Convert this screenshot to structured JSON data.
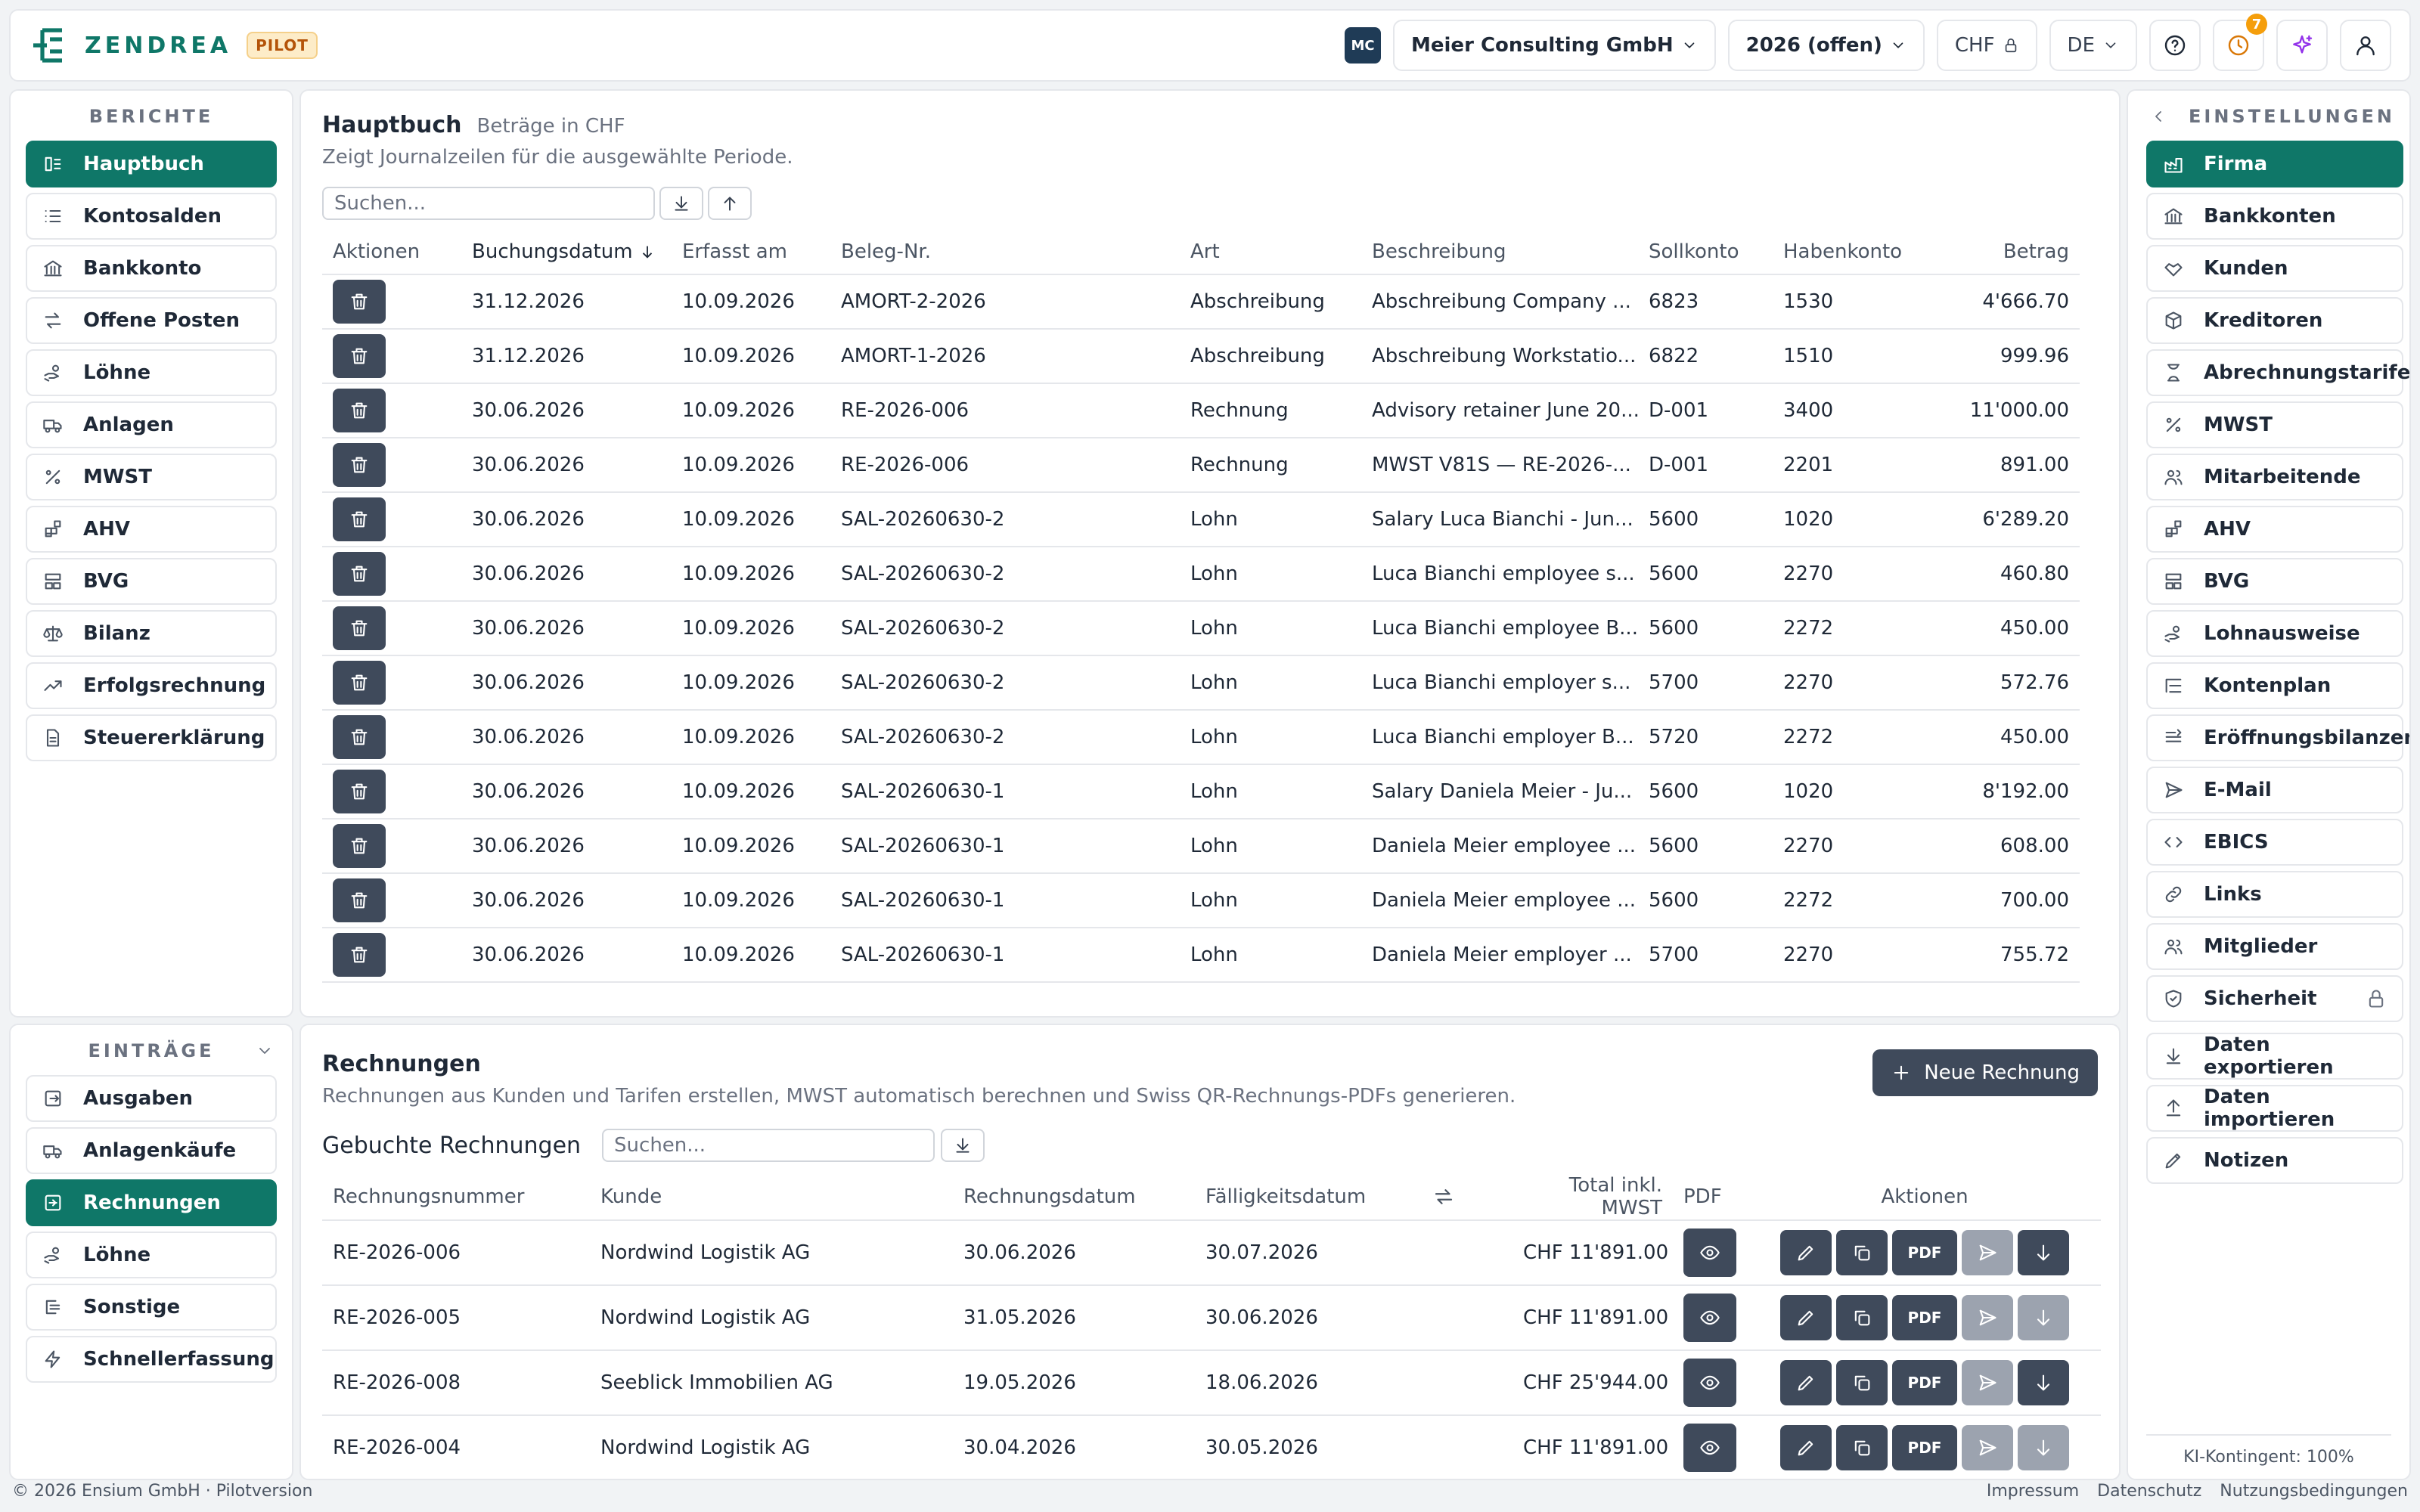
{
  "brand": {
    "name": "ZENDREA",
    "badge": "PILOT"
  },
  "topbar": {
    "company_initials": "MC",
    "company": "Meier Consulting GmbH",
    "year": "2026 (offen)",
    "currency": "CHF",
    "language": "DE",
    "notifications": "7"
  },
  "reports_nav": {
    "title": "BERICHTE",
    "items": [
      {
        "label": "Hauptbuch",
        "icon": "ledger-icon",
        "active": true
      },
      {
        "label": "Kontosalden",
        "icon": "list-icon"
      },
      {
        "label": "Bankkonto",
        "icon": "bank-icon"
      },
      {
        "label": "Offene Posten",
        "icon": "swap-icon"
      },
      {
        "label": "Löhne",
        "icon": "hand-coins-icon"
      },
      {
        "label": "Anlagen",
        "icon": "truck-icon"
      },
      {
        "label": "MWST",
        "icon": "percent-icon"
      },
      {
        "label": "AHV",
        "icon": "blocks-icon"
      },
      {
        "label": "BVG",
        "icon": "layout-icon"
      },
      {
        "label": "Bilanz",
        "icon": "scale-icon"
      },
      {
        "label": "Erfolgsrechnung",
        "icon": "trend-icon"
      },
      {
        "label": "Steuererklärung",
        "icon": "file-icon"
      }
    ]
  },
  "entries_nav": {
    "title": "EINTRÄGE",
    "items": [
      {
        "label": "Ausgaben",
        "icon": "receipt-icon"
      },
      {
        "label": "Anlagenkäufe",
        "icon": "truck-icon"
      },
      {
        "label": "Rechnungen",
        "icon": "invoice-icon",
        "active": true
      },
      {
        "label": "Löhne",
        "icon": "hand-coins-icon"
      },
      {
        "label": "Sonstige",
        "icon": "misc-icon"
      },
      {
        "label": "Schnellerfassung",
        "icon": "zap-icon"
      }
    ]
  },
  "settings_nav": {
    "title": "EINSTELLUNGEN",
    "items": [
      {
        "label": "Firma",
        "icon": "factory-icon",
        "active": true
      },
      {
        "label": "Bankkonten",
        "icon": "bank-icon"
      },
      {
        "label": "Kunden",
        "icon": "handshake-icon"
      },
      {
        "label": "Kreditoren",
        "icon": "package-icon"
      },
      {
        "label": "Abrechnungstarife",
        "icon": "hourglass-icon"
      },
      {
        "label": "MWST",
        "icon": "percent-icon"
      },
      {
        "label": "Mitarbeitende",
        "icon": "users-icon"
      },
      {
        "label": "AHV",
        "icon": "blocks-icon"
      },
      {
        "label": "BVG",
        "icon": "layout-icon"
      },
      {
        "label": "Lohnausweise",
        "icon": "hand-coins-icon"
      },
      {
        "label": "Kontenplan",
        "icon": "list-tree-icon"
      },
      {
        "label": "Eröffnungsbilanzen",
        "icon": "opening-icon"
      },
      {
        "label": "E-Mail",
        "icon": "send-icon"
      },
      {
        "label": "EBICS",
        "icon": "code-icon"
      },
      {
        "label": "Links",
        "icon": "link-icon"
      },
      {
        "label": "Mitglieder",
        "icon": "users-icon"
      },
      {
        "label": "Sicherheit",
        "icon": "shield-icon",
        "lock": true
      }
    ],
    "extra": [
      {
        "label": "Daten exportieren",
        "icon": "download-icon"
      },
      {
        "label": "Daten importieren",
        "icon": "upload-icon"
      },
      {
        "label": "Notizen",
        "icon": "pen-icon"
      }
    ],
    "ai_quota": "KI-Kontingent: 100%"
  },
  "ledger": {
    "title": "Hauptbuch",
    "currency_note": "Beträge in CHF",
    "subtitle": "Zeigt Journalzeilen für die ausgewählte Periode.",
    "search_placeholder": "Suchen...",
    "columns": [
      "Aktionen",
      "Buchungsdatum",
      "Erfasst am",
      "Beleg-Nr.",
      "Art",
      "Beschreibung",
      "Sollkonto",
      "Habenkonto",
      "Betrag"
    ],
    "rows": [
      [
        "31.12.2026",
        "10.09.2026",
        "AMORT-2-2026",
        "Abschreibung",
        "Abschreibung Company ...",
        "6823",
        "1530",
        "4'666.70"
      ],
      [
        "31.12.2026",
        "10.09.2026",
        "AMORT-1-2026",
        "Abschreibung",
        "Abschreibung Workstatio...",
        "6822",
        "1510",
        "999.96"
      ],
      [
        "30.06.2026",
        "10.09.2026",
        "RE-2026-006",
        "Rechnung",
        "Advisory retainer June 20...",
        "D-001",
        "3400",
        "11'000.00"
      ],
      [
        "30.06.2026",
        "10.09.2026",
        "RE-2026-006",
        "Rechnung",
        "MWST V81S — RE-2026-...",
        "D-001",
        "2201",
        "891.00"
      ],
      [
        "30.06.2026",
        "10.09.2026",
        "SAL-20260630-2",
        "Lohn",
        "Salary Luca Bianchi - Jun...",
        "5600",
        "1020",
        "6'289.20"
      ],
      [
        "30.06.2026",
        "10.09.2026",
        "SAL-20260630-2",
        "Lohn",
        "Luca Bianchi employee s...",
        "5600",
        "2270",
        "460.80"
      ],
      [
        "30.06.2026",
        "10.09.2026",
        "SAL-20260630-2",
        "Lohn",
        "Luca Bianchi employee B...",
        "5600",
        "2272",
        "450.00"
      ],
      [
        "30.06.2026",
        "10.09.2026",
        "SAL-20260630-2",
        "Lohn",
        "Luca Bianchi employer s...",
        "5700",
        "2270",
        "572.76"
      ],
      [
        "30.06.2026",
        "10.09.2026",
        "SAL-20260630-2",
        "Lohn",
        "Luca Bianchi employer B...",
        "5720",
        "2272",
        "450.00"
      ],
      [
        "30.06.2026",
        "10.09.2026",
        "SAL-20260630-1",
        "Lohn",
        "Salary Daniela Meier - Ju...",
        "5600",
        "1020",
        "8'192.00"
      ],
      [
        "30.06.2026",
        "10.09.2026",
        "SAL-20260630-1",
        "Lohn",
        "Daniela Meier employee ...",
        "5600",
        "2270",
        "608.00"
      ],
      [
        "30.06.2026",
        "10.09.2026",
        "SAL-20260630-1",
        "Lohn",
        "Daniela Meier employee ...",
        "5600",
        "2272",
        "700.00"
      ],
      [
        "30.06.2026",
        "10.09.2026",
        "SAL-20260630-1",
        "Lohn",
        "Daniela Meier employer ...",
        "5700",
        "2270",
        "755.72"
      ]
    ]
  },
  "invoices": {
    "title": "Rechnungen",
    "subtitle": "Rechnungen aus Kunden und Tarifen erstellen, MWST automatisch berechnen und Swiss QR-Rechnungs-PDFs generieren.",
    "new_button": "Neue Rechnung",
    "section": "Gebuchte Rechnungen",
    "search_placeholder": "Suchen...",
    "columns": [
      "Rechnungsnummer",
      "Kunde",
      "Rechnungsdatum",
      "Fälligkeitsdatum",
      "Total inkl. MWST",
      "PDF",
      "Aktionen"
    ],
    "pdf_label": "PDF",
    "rows": [
      {
        "nr": "RE-2026-006",
        "kunde": "Nordwind Logistik AG",
        "datum": "30.06.2026",
        "faellig": "30.07.2026",
        "total": "CHF 11'891.00",
        "download_enabled": true
      },
      {
        "nr": "RE-2026-005",
        "kunde": "Nordwind Logistik AG",
        "datum": "31.05.2026",
        "faellig": "30.06.2026",
        "total": "CHF 11'891.00",
        "download_enabled": false
      },
      {
        "nr": "RE-2026-008",
        "kunde": "Seeblick Immobilien AG",
        "datum": "19.05.2026",
        "faellig": "18.06.2026",
        "total": "CHF 25'944.00",
        "download_enabled": true
      },
      {
        "nr": "RE-2026-004",
        "kunde": "Nordwind Logistik AG",
        "datum": "30.04.2026",
        "faellig": "30.05.2026",
        "total": "CHF 11'891.00",
        "download_enabled": false
      }
    ]
  },
  "footer": {
    "copyright": "© 2026 Ensium GmbH · Pilotversion",
    "links": [
      "Impressum",
      "Datenschutz",
      "Nutzungsbedingungen"
    ]
  }
}
